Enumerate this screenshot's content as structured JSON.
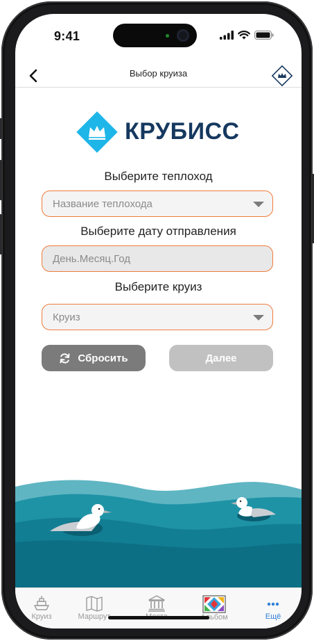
{
  "status_bar": {
    "time": "9:41"
  },
  "nav": {
    "title": "Выбор круиза"
  },
  "brand": {
    "name": "КРУБИСС"
  },
  "form": {
    "ship_label": "Выберите теплоход",
    "ship_placeholder": "Название теплохода",
    "date_label": "Выберите дату отправления",
    "date_placeholder": "День.Месяц.Год",
    "cruise_label": "Выберите круиз",
    "cruise_placeholder": "Круиз"
  },
  "buttons": {
    "reset": "Сбросить",
    "next": "Далее"
  },
  "tabs": [
    {
      "label": "Круиз",
      "icon": "ship-icon"
    },
    {
      "label": "Маршрут",
      "icon": "map-icon"
    },
    {
      "label": "Места",
      "icon": "museum-icon"
    },
    {
      "label": "Альбом",
      "icon": "album-icon"
    },
    {
      "label": "Ещё",
      "icon": "more-icon"
    }
  ],
  "colors": {
    "accent": "#f07c3b",
    "brand": "#16385f",
    "brand_icon": "#1eb6e8",
    "active_tab": "#2f7fd6"
  }
}
